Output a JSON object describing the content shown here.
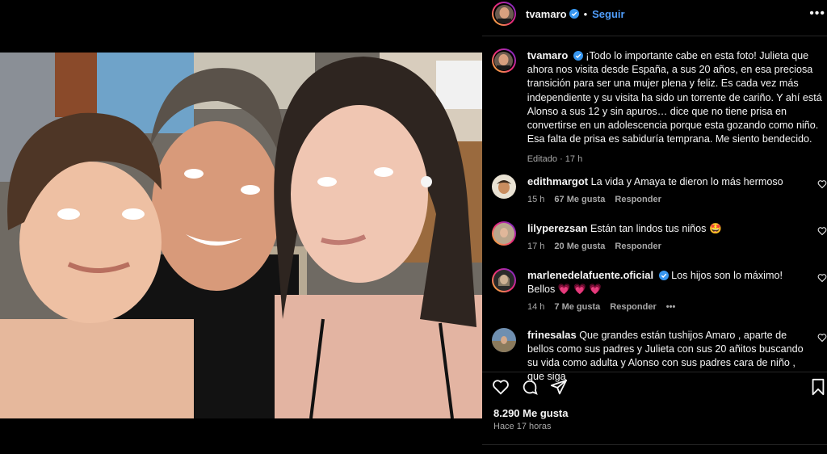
{
  "post": {
    "author": "tvamaro",
    "follow_label": "Seguir",
    "more_label": "•••"
  },
  "caption": {
    "username": "tvamaro",
    "text": "¡Todo lo importante cabe en esta foto! Julieta que ahora nos visita desde España, a sus 20 años, en esa preciosa transición para ser una mujer plena y feliz. Es cada vez más independiente y su visita ha sido un torrente de cariño. Y ahí está Alonso a sus 12 y sin apuros… dice que no tiene prisa en convertirse en un adolescencia porque esta gozando como niño. Esa falta de prisa es sabiduría temprana. Me siento bendecido.",
    "edited": "Editado",
    "time": "17 h"
  },
  "comments": [
    {
      "username": "edithmargot",
      "text": "La vida y Amaya te dieron lo más hermoso",
      "time": "15 h",
      "likes": "67 Me gusta",
      "reply": "Responder"
    },
    {
      "username": "lilyperezsan",
      "text": "Están tan lindos tus niños 🤩",
      "time": "17 h",
      "likes": "20 Me gusta",
      "reply": "Responder"
    },
    {
      "username": "marlenedelafuente.oficial",
      "text": "Los hijos son lo máximo!",
      "line2": "Bellos 💗 💗 💗",
      "time": "14 h",
      "likes": "7 Me gusta",
      "reply": "Responder",
      "more": "•••"
    },
    {
      "username": "frinesalas",
      "text": "Que grandes están tushijos Amaro , aparte de bellos como sus padres y Julieta con sus 20 añitos buscando su vida como adulta y Alonso con sus padres cara de niño , que siga"
    }
  ],
  "stats": {
    "likes": "8.290 Me gusta",
    "ago": "Hace 17 horas"
  },
  "icons": {
    "like": "heart-icon",
    "comment": "comment-icon",
    "share": "share-icon",
    "save": "bookmark-icon",
    "verified": "verified-badge-icon"
  },
  "colors": {
    "background": "#000000",
    "link": "#4f9cf9",
    "verified": "#3897f0",
    "muted": "#a8a8a8"
  }
}
